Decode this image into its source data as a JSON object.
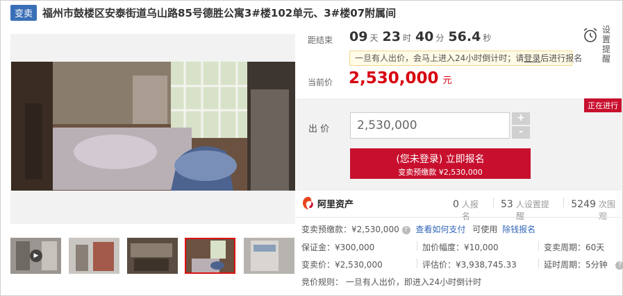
{
  "header": {
    "tag": "变卖",
    "title": "福州市鼓楼区安泰街道乌山路85号德胜公寓3#楼102单元、3#楼07附属间"
  },
  "countdown": {
    "label": "距结束",
    "days": "09",
    "days_unit": "天",
    "hours": "23",
    "hours_unit": "时",
    "minutes": "40",
    "minutes_unit": "分",
    "seconds": "56.4",
    "seconds_unit": "秒"
  },
  "reminder": {
    "line1": "设置",
    "line2": "提醒",
    "icon": "alarm-clock-icon"
  },
  "notice": {
    "before": "一旦有人出价，会马上进入24小时倒计时；请",
    "login": "登录",
    "after": "后进行报名"
  },
  "current_price": {
    "label": "当前价",
    "value": "2,530,000",
    "unit": "元"
  },
  "bid": {
    "status": "正在进行",
    "label": "出 价",
    "value": "2,530,000",
    "plus": "+",
    "minus": "-",
    "signup_main": "(您未登录) 立即报名",
    "signup_sub": "变卖预缴款 ¥2,530,000"
  },
  "platform": {
    "name": "阿里资产",
    "icon": "alibaba-assets-logo"
  },
  "stats": [
    {
      "n": "0",
      "label": "人报名"
    },
    {
      "n": "53",
      "label": "人设置提醒"
    },
    {
      "n": "5249",
      "label": "次围观"
    }
  ],
  "details": {
    "deposit": "变卖预缴款：¥2,530,000",
    "pay_link": "查看如何支付",
    "usable": "可使用",
    "insurance_link": "除钱报名",
    "margin": "保证金：¥300,000",
    "increment": "加价幅度：¥10,000",
    "period": "变卖周期：60天",
    "sale_price": "变卖价：¥2,530,000",
    "appraisal": "评估价：¥3,938,745.33",
    "delay": "延时周期：5分钟",
    "rule": "竞价规则：  一旦有人出价，即进入24小时倒计时"
  },
  "colors": {
    "accent": "#c8102e",
    "tag": "#3a6fb7",
    "link": "#3367b9"
  }
}
